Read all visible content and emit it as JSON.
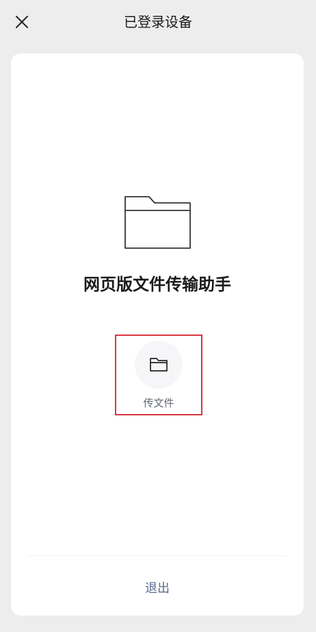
{
  "header": {
    "title": "已登录设备",
    "close_icon": "close-icon"
  },
  "device": {
    "name": "网页版文件传输助手",
    "illustration_icon": "folder-icon"
  },
  "actions": {
    "transfer_label": "传文件",
    "transfer_icon": "folder-icon"
  },
  "footer": {
    "logout_label": "退出"
  },
  "colors": {
    "page_bg": "#ededed",
    "card_bg": "#ffffff",
    "highlight_border": "#d9363e",
    "logout_text": "#5a6b8c",
    "secondary_text": "#666a75"
  }
}
